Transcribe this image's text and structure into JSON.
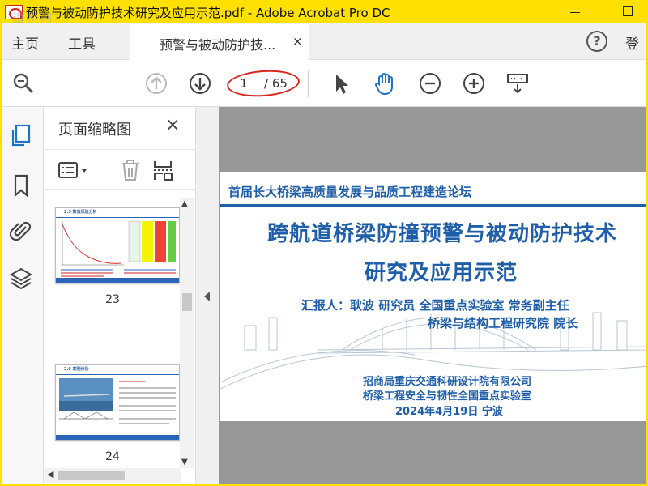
{
  "window": {
    "title": "预警与被动防护技术研究及应用示范.pdf - Adobe Acrobat Pro DC",
    "watermark": "道桥网"
  },
  "menu": {
    "home": "主页",
    "tools": "工具",
    "doc_tab": "预警与被动防护技...",
    "doc_tab_close": "×",
    "help": "?",
    "signin": "登"
  },
  "toolbar": {
    "page_current": "1",
    "page_total": "/ 65"
  },
  "thumbnails_panel": {
    "title": "页面缩略图",
    "close": "×",
    "thumbs": [
      {
        "label": "23",
        "heading": "2.5 数值风险分析"
      },
      {
        "label": "24",
        "heading": "2.6 案例分析"
      }
    ]
  },
  "slide": {
    "forum": "首届长大桥梁高质量发展与品质工程建造论坛",
    "title_line1": "跨航道桥梁防撞预警与被动防护技术",
    "title_line2": "研究及应用示范",
    "reporter_line1": "汇报人：耿波  研究员  全国重点实验室 常务副主任",
    "reporter_line2": "桥梁与结构工程研究院  院长",
    "org_line1": "招商局重庆交通科研设计院有限公司",
    "org_line2": "桥梁工程安全与韧性全国重点实验室",
    "date_line": "2024年4月19日  宁波"
  },
  "colors": {
    "frame": "#ffe000",
    "slide_blue": "#1f5ea8",
    "annotation_red": "#d8271c",
    "doc_background": "#989898"
  }
}
